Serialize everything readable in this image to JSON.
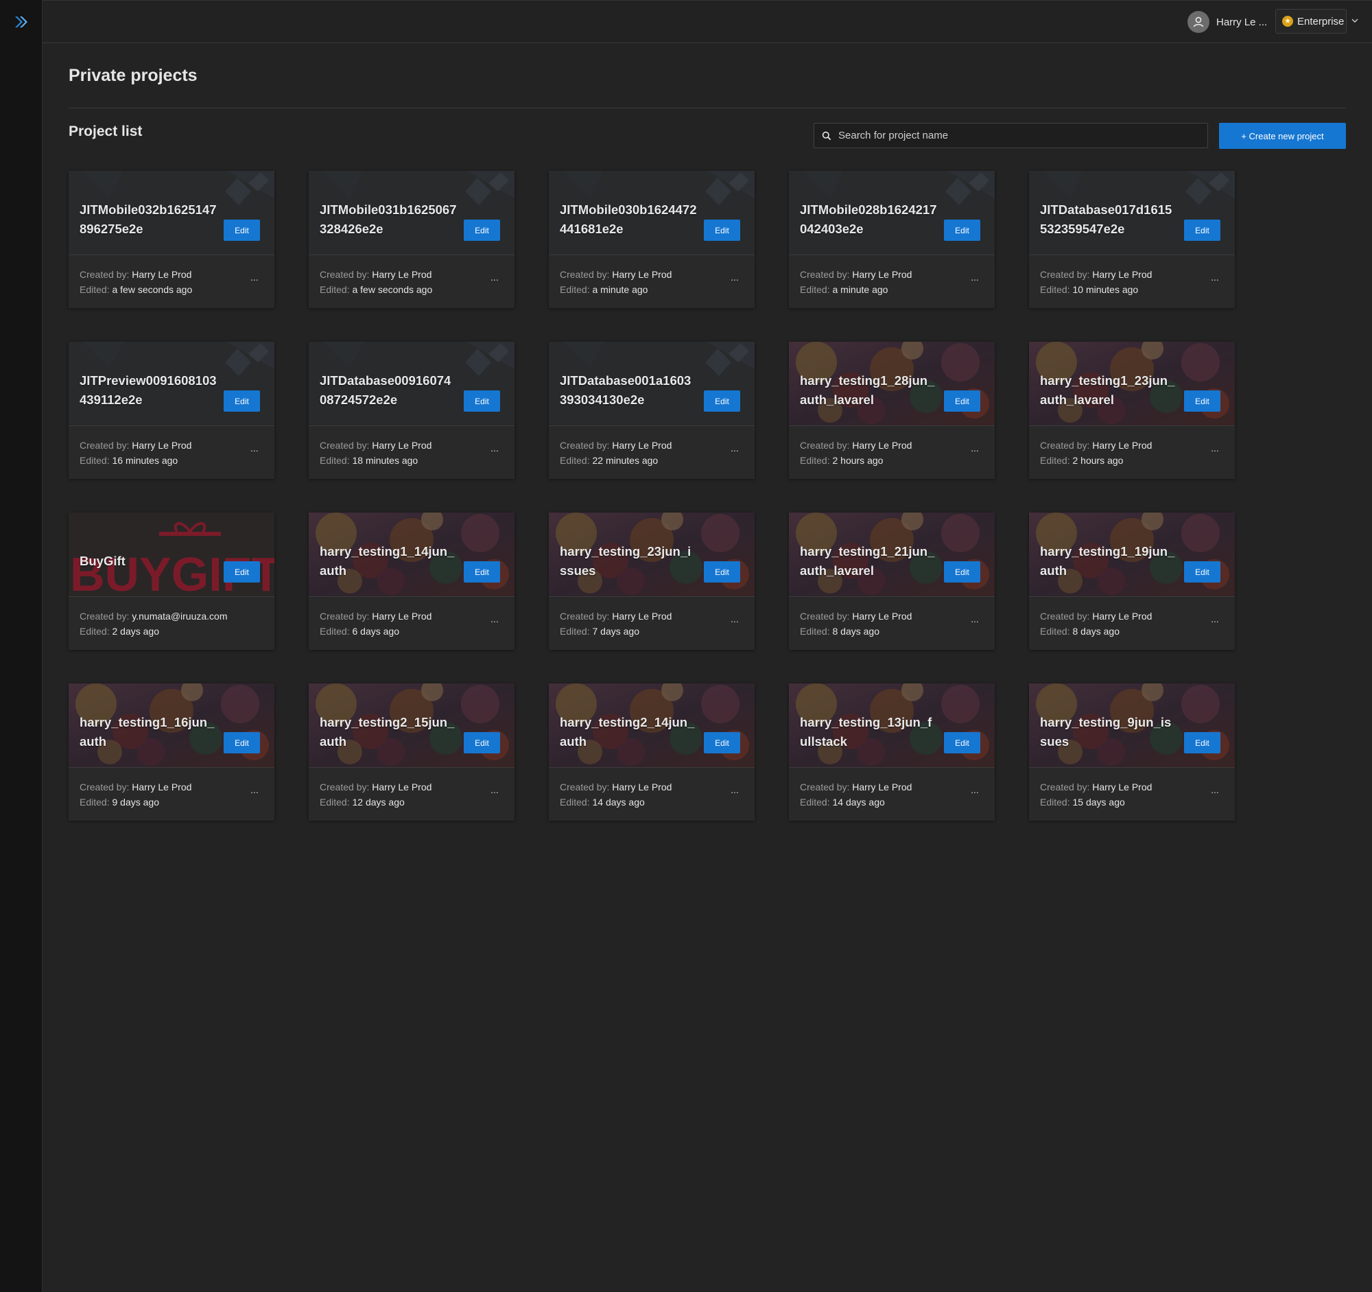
{
  "header": {
    "user_name": "Harry Le ...",
    "plan": "Enterprise"
  },
  "page": {
    "title": "Private projects",
    "section_title": "Project list"
  },
  "search": {
    "placeholder": "Search for project name"
  },
  "actions": {
    "create_label": "+ Create new project"
  },
  "labels": {
    "created_by": "Created by:",
    "edited": "Edited:",
    "edit": "Edit",
    "more": "..."
  },
  "colors": {
    "accent": "#1677d2",
    "background": "#232323",
    "card": "#292929",
    "sidebar": "#141414"
  },
  "projects": [
    {
      "name": "JITMobile032b1625147896275e2e",
      "thumb": "default",
      "created_by": "Harry Le Prod",
      "edited": "a few seconds ago"
    },
    {
      "name": "JITMobile031b1625067328426e2e",
      "thumb": "default",
      "created_by": "Harry Le Prod",
      "edited": "a few seconds ago"
    },
    {
      "name": "JITMobile030b1624472441681e2e",
      "thumb": "default",
      "created_by": "Harry Le Prod",
      "edited": "a minute ago"
    },
    {
      "name": "JITMobile028b1624217042403e2e",
      "thumb": "default",
      "created_by": "Harry Le Prod",
      "edited": "a minute ago"
    },
    {
      "name": "JITDatabase017d1615532359547e2e",
      "thumb": "default",
      "created_by": "Harry Le Prod",
      "edited": "10 minutes ago"
    },
    {
      "name": "JITPreview0091608103439112e2e",
      "thumb": "default",
      "created_by": "Harry Le Prod",
      "edited": "16 minutes ago"
    },
    {
      "name": "JITDatabase0091607408724572e2e",
      "thumb": "default",
      "created_by": "Harry Le Prod",
      "edited": "18 minutes ago"
    },
    {
      "name": "JITDatabase001a1603393034130e2e",
      "thumb": "default",
      "created_by": "Harry Le Prod",
      "edited": "22 minutes ago"
    },
    {
      "name": "harry_testing1_28jun_auth_lavarel",
      "thumb": "anime",
      "created_by": "Harry Le Prod",
      "edited": "2 hours ago"
    },
    {
      "name": "harry_testing1_23jun_auth_lavarel",
      "thumb": "anime",
      "created_by": "Harry Le Prod",
      "edited": "2 hours ago"
    },
    {
      "name": "BuyGift",
      "thumb": "buygift",
      "thumb_text": "BUYGIFT",
      "created_by": "y.numata@iruuza.com",
      "edited": "2 days ago"
    },
    {
      "name": "harry_testing1_14jun_auth",
      "thumb": "anime",
      "created_by": "Harry Le Prod",
      "edited": "6 days ago"
    },
    {
      "name": "harry_testing_23jun_issues",
      "thumb": "anime",
      "created_by": "Harry Le Prod",
      "edited": "7 days ago"
    },
    {
      "name": "harry_testing1_21jun_auth_lavarel",
      "thumb": "anime",
      "created_by": "Harry Le Prod",
      "edited": "8 days ago"
    },
    {
      "name": "harry_testing1_19jun_auth",
      "thumb": "anime",
      "created_by": "Harry Le Prod",
      "edited": "8 days ago"
    },
    {
      "name": "harry_testing1_16jun_auth",
      "thumb": "anime",
      "created_by": "Harry Le Prod",
      "edited": "9 days ago"
    },
    {
      "name": "harry_testing2_15jun_auth",
      "thumb": "anime",
      "created_by": "Harry Le Prod",
      "edited": "12 days ago"
    },
    {
      "name": "harry_testing2_14jun_auth",
      "thumb": "anime",
      "created_by": "Harry Le Prod",
      "edited": "14 days ago"
    },
    {
      "name": "harry_testing_13jun_fullstack",
      "thumb": "anime",
      "created_by": "Harry Le Prod",
      "edited": "14 days ago"
    },
    {
      "name": "harry_testing_9jun_issues",
      "thumb": "anime",
      "created_by": "Harry Le Prod",
      "edited": "15 days ago"
    }
  ]
}
